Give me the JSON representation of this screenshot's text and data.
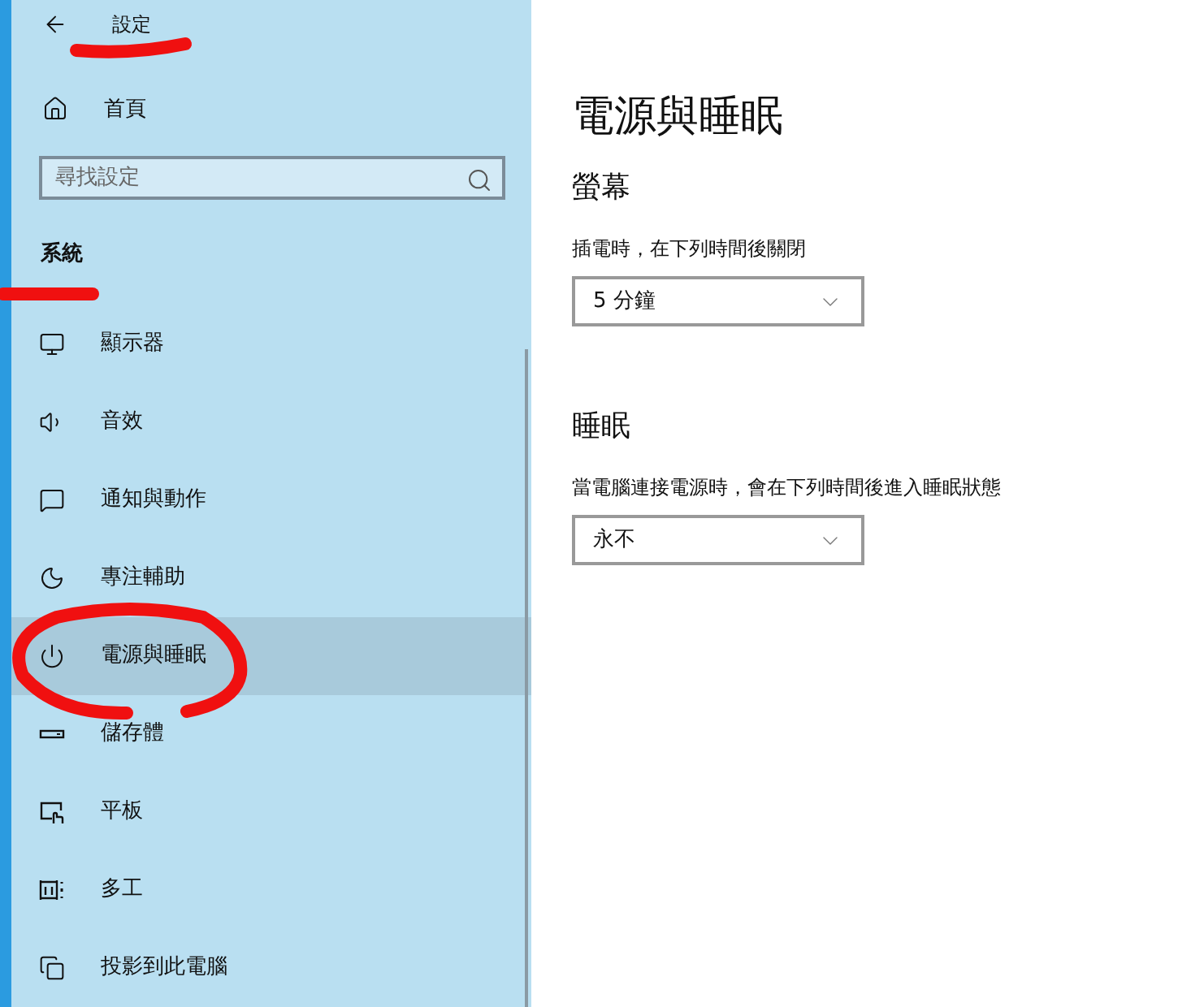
{
  "window": {
    "title": "設定"
  },
  "home": {
    "label": "首頁"
  },
  "search": {
    "placeholder": "尋找設定"
  },
  "section_title": "系統",
  "nav_items": [
    {
      "label": "顯示器",
      "selected": false
    },
    {
      "label": "音效",
      "selected": false
    },
    {
      "label": "通知與動作",
      "selected": false
    },
    {
      "label": "專注輔助",
      "selected": false
    },
    {
      "label": "電源與睡眠",
      "selected": true
    },
    {
      "label": "儲存體",
      "selected": false
    },
    {
      "label": "平板",
      "selected": false
    },
    {
      "label": "多工",
      "selected": false
    },
    {
      "label": "投影到此電腦",
      "selected": false
    }
  ],
  "page_title": "電源與睡眠",
  "sections": [
    {
      "heading": "螢幕",
      "label": "插電時，在下列時間後關閉",
      "value": "5 分鐘"
    },
    {
      "heading": "睡眠",
      "label": "當電腦連接電源時，會在下列時間後進入睡眠狀態",
      "value": "永不"
    }
  ]
}
